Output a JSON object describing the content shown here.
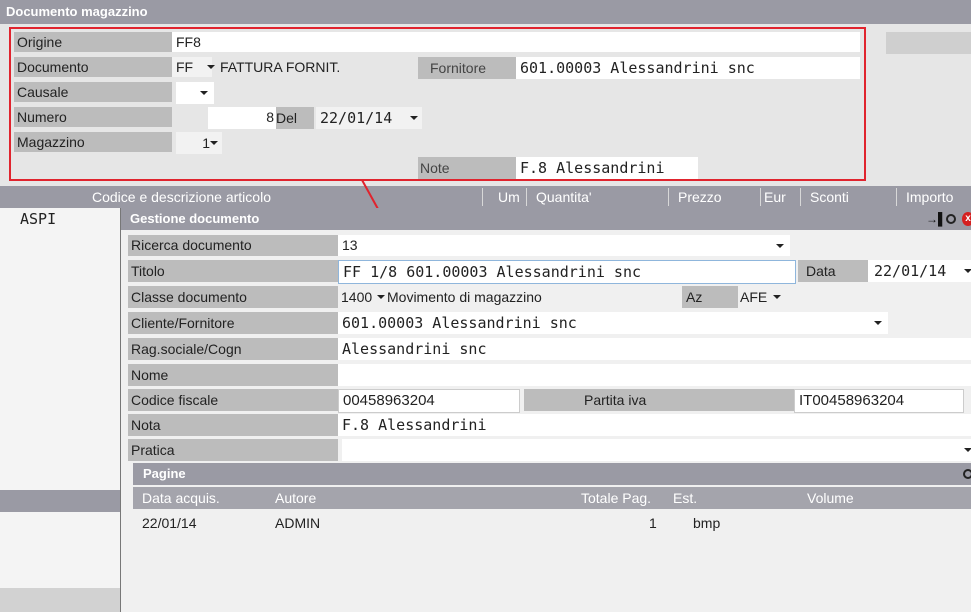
{
  "outer": {
    "title": "Documento magazzino",
    "origine": {
      "label": "Origine",
      "value": "FF8"
    },
    "documento": {
      "label": "Documento",
      "code": "FF",
      "desc": "FATTURA FORNIT."
    },
    "fornitore": {
      "label": "Fornitore",
      "value": "601.00003 Alessandrini snc"
    },
    "causale": {
      "label": "Causale",
      "value": ""
    },
    "numero": {
      "label": "Numero",
      "value": "8"
    },
    "del": {
      "label": "Del",
      "value": "22/01/14"
    },
    "magazzino": {
      "label": "Magazzino",
      "value": "1"
    },
    "note": {
      "label": "Note",
      "value": "F.8 Alessandrini"
    },
    "grid_headers": [
      "Codice e descrizione articolo",
      "Um",
      "Quantita'",
      "Prezzo",
      "Eur",
      "Sconti",
      "Importo"
    ],
    "row_code": "ASPI"
  },
  "dialog": {
    "title": "Gestione documento",
    "ricerca": {
      "label": "Ricerca documento",
      "value": "13"
    },
    "titolo": {
      "label": "Titolo",
      "value": "FF 1/8 601.00003 Alessandrini snc"
    },
    "data": {
      "label": "Data",
      "value": "22/01/14"
    },
    "classe": {
      "label": "Classe documento",
      "code": "1400",
      "desc": "Movimento di magazzino"
    },
    "az": {
      "label": "Az",
      "value": "AFE"
    },
    "cliente": {
      "label": "Cliente/Fornitore",
      "value": "601.00003 Alessandrini snc"
    },
    "ragsoc": {
      "label": "Rag.sociale/Cogn",
      "value": "Alessandrini snc"
    },
    "nome": {
      "label": "Nome",
      "value": ""
    },
    "codfisc": {
      "label": "Codice fiscale",
      "value": "00458963204"
    },
    "piva": {
      "label": "Partita iva",
      "value": "IT00458963204"
    },
    "nota": {
      "label": "Nota",
      "value": "F.8 Alessandrini"
    },
    "pratica": {
      "label": "Pratica",
      "value": ""
    }
  },
  "pagine": {
    "title": "Pagine",
    "columns": [
      "Data acquis.",
      "Autore",
      "Totale Pag.",
      "Est.",
      "Volume"
    ],
    "rows": [
      {
        "data": "22/01/14",
        "autore": "ADMIN",
        "totale": "1",
        "est": "bmp",
        "volume": ""
      }
    ]
  },
  "colors": {
    "highlight": "#e0242e",
    "title_bar": "#9a9aa4",
    "label_bg": "#bcbcbc"
  }
}
